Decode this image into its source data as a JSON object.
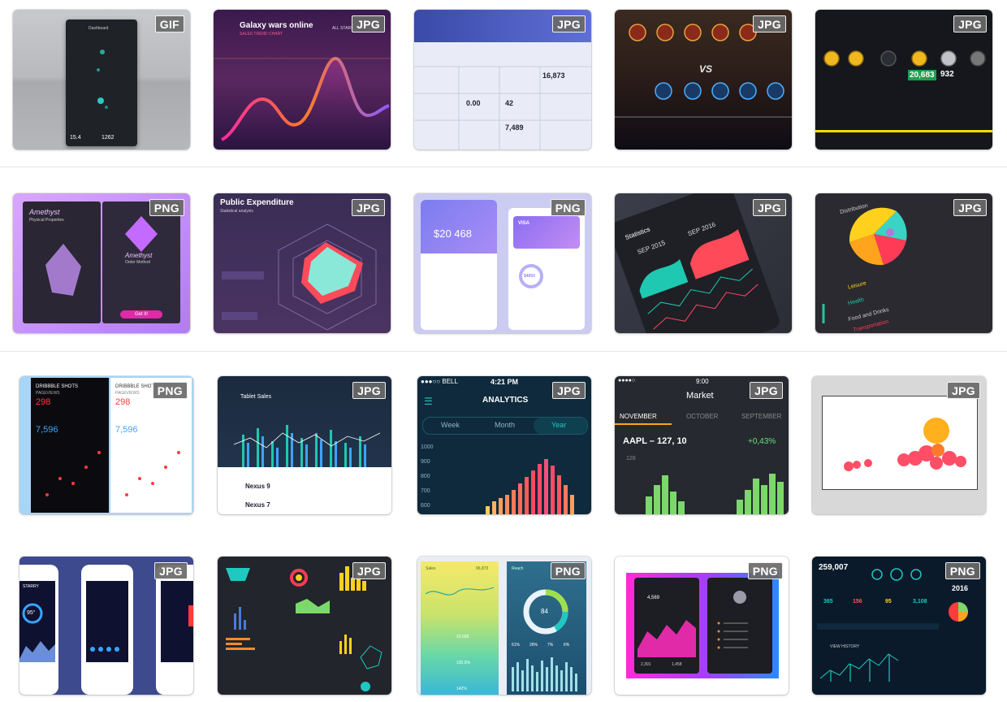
{
  "gallery": {
    "tiles": [
      {
        "badge": "GIF",
        "texts": [
          "Dashboard",
          "15.4",
          "1262"
        ]
      },
      {
        "badge": "JPG",
        "texts": [
          "Galaxy wars online",
          "SALES TREND CHART",
          "ALL STARS"
        ]
      },
      {
        "badge": "JPG",
        "texts": [
          "16,873",
          "0.00",
          "42",
          "7,489"
        ]
      },
      {
        "badge": "JPG",
        "texts": [
          "VS"
        ]
      },
      {
        "badge": "JPG",
        "texts": [
          "20,683",
          "932"
        ]
      },
      {
        "badge": "PNG",
        "texts": [
          "Amethyst",
          "Physical Properties",
          "Amethyst",
          "Order Method",
          "Get it!"
        ]
      },
      {
        "badge": "JPG",
        "texts": [
          "Public Expenditure",
          "Statistical analysis"
        ]
      },
      {
        "badge": "PNG",
        "texts": [
          "$20 468",
          "$4850",
          "VISA"
        ]
      },
      {
        "badge": "JPG",
        "texts": [
          "Statistics",
          "SEP 2015",
          "SEP 2016"
        ]
      },
      {
        "badge": "JPG",
        "texts": [
          "Distribution",
          "Leisure",
          "Health",
          "Food and Drinks",
          "Transportation"
        ]
      },
      {
        "badge": "PNG",
        "texts": [
          "DRIBBBLE SHOTS",
          "PAGEVIEWS",
          "298",
          "7,596",
          "DRIBBBLE SHOTS",
          "PAGEVIEWS",
          "298",
          "7,596"
        ]
      },
      {
        "badge": "JPG",
        "texts": [
          "Tablet Sales",
          "Nexus 9",
          "Nexus 7"
        ]
      },
      {
        "badge": "JPG",
        "texts": [
          "●●●○○ BELL",
          "4:21 PM",
          "ANALYTICS",
          "Week",
          "Month",
          "Year",
          "1000",
          "900",
          "800",
          "700",
          "600"
        ]
      },
      {
        "badge": "JPG",
        "texts": [
          "●●●●○",
          "9:00",
          "Market",
          "NOVEMBER",
          "OCTOBER",
          "SEPTEMBER",
          "AAPL – 127, 10",
          "+0,43%",
          "128"
        ]
      },
      {
        "badge": "JPG",
        "texts": []
      },
      {
        "badge": "JPG",
        "texts": [
          "STARRY",
          "95°"
        ]
      },
      {
        "badge": "JPG",
        "texts": []
      },
      {
        "badge": "PNG",
        "texts": [
          "Sales",
          "96,873",
          "20,658",
          "130,5%",
          "142%",
          "Reach",
          "84",
          "61%",
          "26%",
          "7%",
          "6%"
        ]
      },
      {
        "badge": "PNG",
        "texts": [
          "4,569",
          "2,391",
          "1,458"
        ]
      },
      {
        "badge": "PNG",
        "texts": [
          "259,007",
          "2016",
          "365",
          "156",
          "95",
          "3,108",
          "VIEW HISTORY"
        ]
      }
    ]
  },
  "colors": {
    "accent_red": "#ff3b56",
    "accent_green": "#66e07a",
    "accent_orange": "#ff8a2a",
    "accent_teal": "#1fc8c0"
  }
}
